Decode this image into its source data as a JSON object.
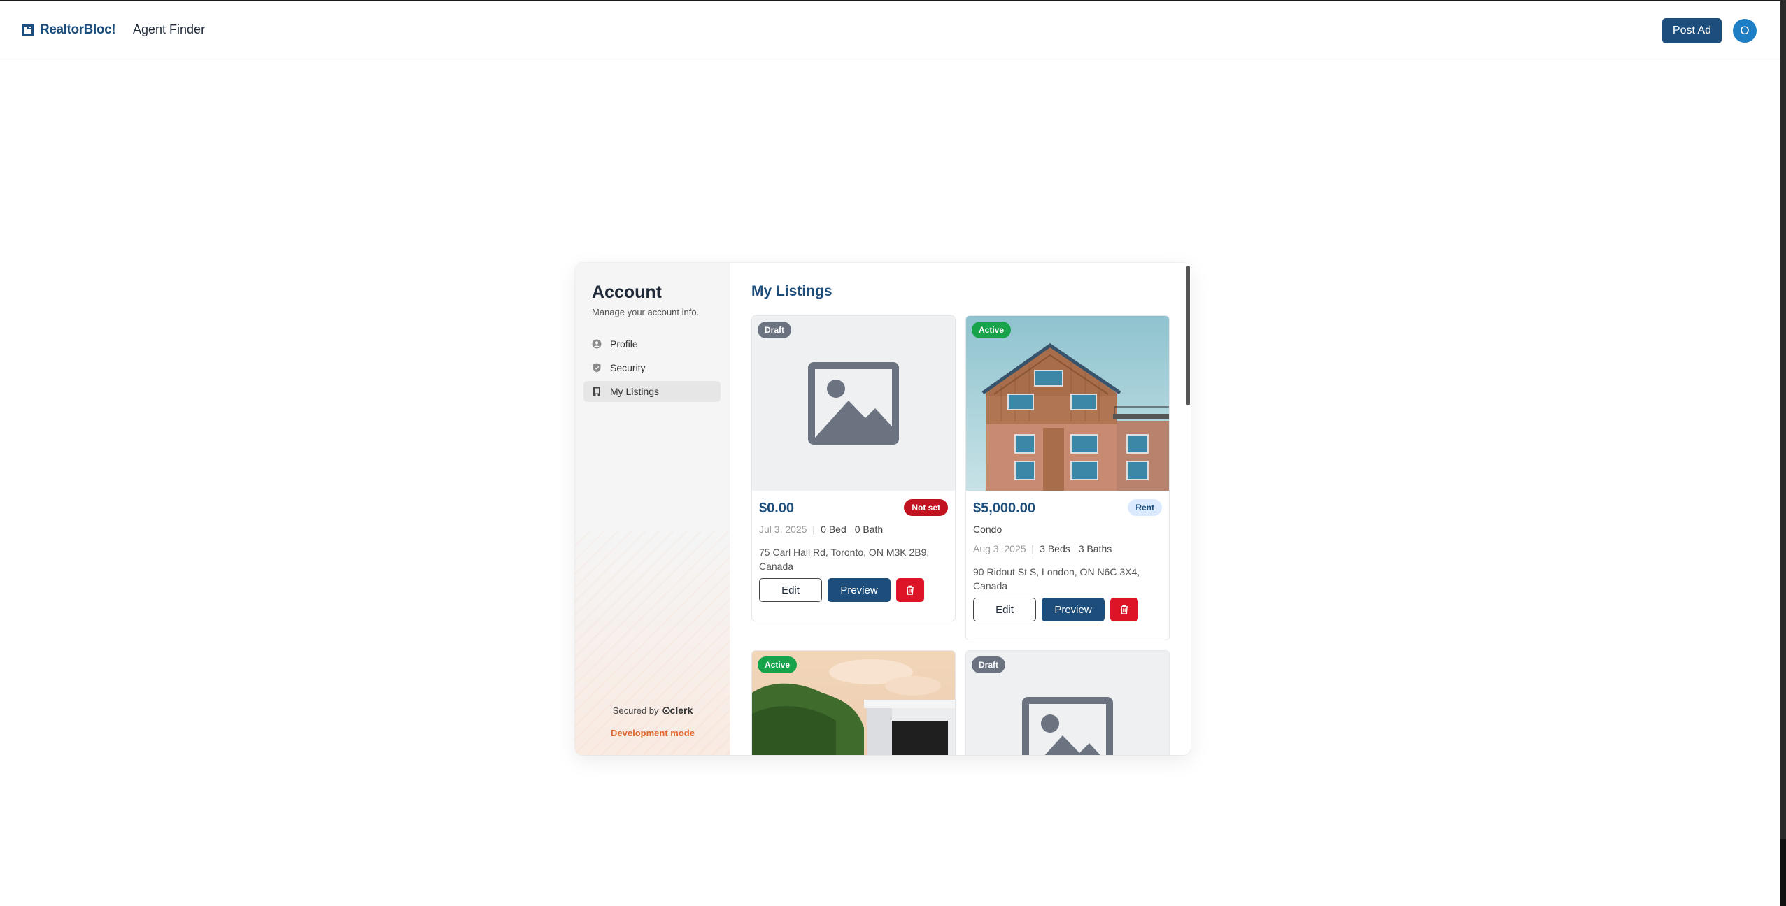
{
  "navbar": {
    "brand": "RealtorBloc!",
    "nav_link": "Agent Finder",
    "post_ad_label": "Post Ad",
    "avatar_initial": "O"
  },
  "account": {
    "title": "Account",
    "subtitle": "Manage your account info.",
    "menu": [
      {
        "label": "Profile",
        "icon": "user-circle-icon"
      },
      {
        "label": "Security",
        "icon": "shield-icon"
      },
      {
        "label": "My Listings",
        "icon": "building-icon",
        "active": true
      }
    ],
    "secured_by": "Secured by",
    "secured_brand": "clerk",
    "dev_mode": "Development mode"
  },
  "listings": {
    "title": "My Listings",
    "cards": [
      {
        "status": "Draft",
        "image": "placeholder-image-icon",
        "price": "$0.00",
        "tag": "Not set",
        "type": "",
        "date": "Jul 3, 2025",
        "beds": "0 Bed",
        "baths": "0 Bath",
        "address": "75 Carl Hall Rd, Toronto, ON M3K 2B9, Canada",
        "edit": "Edit",
        "preview": "Preview"
      },
      {
        "status": "Active",
        "image": "apartment-building-photo",
        "price": "$5,000.00",
        "tag": "Rent",
        "type": "Condo",
        "date": "Aug 3, 2025",
        "beds": "3 Beds",
        "baths": "3 Baths",
        "address": "90 Ridout St S, London, ON N6C 3X4, Canada",
        "edit": "Edit",
        "preview": "Preview"
      },
      {
        "status": "Active",
        "image": "modern-house-photo"
      },
      {
        "status": "Draft",
        "image": "placeholder-image-icon"
      }
    ]
  },
  "colors": {
    "brand": "#1d4d7a",
    "active": "#16a34a",
    "draft": "#6b7280",
    "danger": "#dc1426",
    "dev_mode": "#e2662a"
  }
}
